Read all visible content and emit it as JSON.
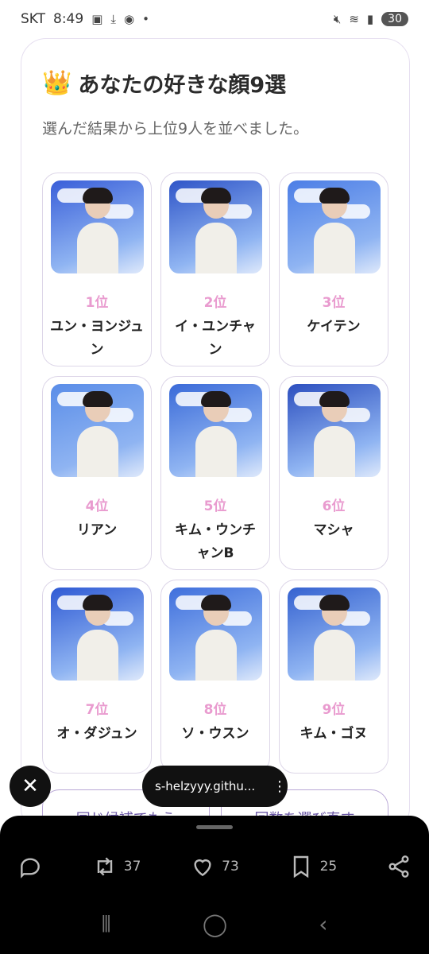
{
  "status_bar": {
    "carrier": "SKT",
    "time": "8:49",
    "battery": "30"
  },
  "header": {
    "title": "あなたの好きな顔9選",
    "subtitle": "選んだ結果から上位9人を並べました。"
  },
  "results": [
    {
      "rank": "1位",
      "name": "ユン・ヨンジュン",
      "bg": "#3a5fd9"
    },
    {
      "rank": "2位",
      "name": "イ・ユンチャン",
      "bg": "#2f55c8"
    },
    {
      "rank": "3位",
      "name": "ケイテン",
      "bg": "#4c7ee6"
    },
    {
      "rank": "4位",
      "name": "リアン",
      "bg": "#5a8de8"
    },
    {
      "rank": "5位",
      "name": "キム・ウンチャンB",
      "bg": "#3a6ad8"
    },
    {
      "rank": "6位",
      "name": "マシャ",
      "bg": "#2c4fbf"
    },
    {
      "rank": "7位",
      "name": "オ・ダジュン",
      "bg": "#2f5ad4"
    },
    {
      "rank": "8位",
      "name": "ソ・ウスン",
      "bg": "#3f6fdc"
    },
    {
      "rank": "9位",
      "name": "キム・ゴヌ",
      "bg": "#3562d0"
    }
  ],
  "buttons": {
    "same_candidates": "同じ候補でもう",
    "choose_again": "回数を選び直す"
  },
  "browser": {
    "url": "s-helzyyy.githu..."
  },
  "social": {
    "retweets": "37",
    "likes": "73",
    "bookmarks": "25"
  },
  "colors": {
    "rank_pink": "#e99bcf",
    "button_purple": "#6b57a5"
  }
}
